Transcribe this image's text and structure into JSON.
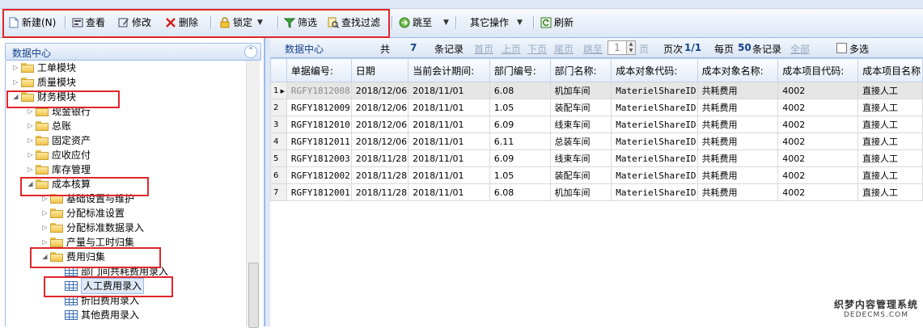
{
  "toolbar": {
    "new": "新建(N)",
    "view": "查看",
    "modify": "修改",
    "delete": "删除",
    "lock": "锁定",
    "filter": "筛选",
    "find_filter": "查找过滤",
    "jump": "跳至",
    "other_ops": "其它操作",
    "refresh": "刷新"
  },
  "left_panel": {
    "title": "数据中心",
    "tree": [
      {
        "label": "工单模块",
        "level": 0,
        "expanded": false
      },
      {
        "label": "质量模块",
        "level": 0,
        "expanded": false
      },
      {
        "label": "财务模块",
        "level": 0,
        "expanded": true
      },
      {
        "label": "现金银行",
        "level": 1,
        "expanded": false
      },
      {
        "label": "总账",
        "level": 1,
        "expanded": false
      },
      {
        "label": "固定资产",
        "level": 1,
        "expanded": false
      },
      {
        "label": "应收应付",
        "level": 1,
        "expanded": false
      },
      {
        "label": "库存管理",
        "level": 1,
        "expanded": false
      },
      {
        "label": "成本核算",
        "level": 1,
        "expanded": true
      },
      {
        "label": "基础设置与维护",
        "level": 2,
        "expanded": false
      },
      {
        "label": "分配标准设置",
        "level": 2,
        "expanded": false
      },
      {
        "label": "分配标准数据录入",
        "level": 2,
        "expanded": false
      },
      {
        "label": "产量与工时归集",
        "level": 2,
        "expanded": false
      },
      {
        "label": "费用归集",
        "level": 2,
        "expanded": true
      },
      {
        "label": "部门间共耗费用录入",
        "level": 3,
        "leaf": true
      },
      {
        "label": "人工费用录入",
        "level": 3,
        "leaf": true,
        "selected": true
      },
      {
        "label": "折旧费用录入",
        "level": 3,
        "leaf": true
      },
      {
        "label": "其他费用录入",
        "level": 3,
        "leaf": true
      }
    ]
  },
  "pager": {
    "title": "数据中心",
    "total_label": "共",
    "total": "7",
    "records_label": "条记录",
    "first": "首页",
    "prev": "上页",
    "next": "下页",
    "last": "尾页",
    "goto": "跳至",
    "page_input": "1",
    "page_unit": "页",
    "page_no_label": "页次",
    "page_no": "1/1",
    "per_page_label": "每页",
    "per_page": "50",
    "per_page_unit": "条记录",
    "all": "全部",
    "multi_select": "多选"
  },
  "grid": {
    "columns": [
      "单据编号:",
      "日期",
      "当前会计期间:",
      "部门编号:",
      "部门名称:",
      "成本对象代码:",
      "成本对象名称:",
      "成本项目代码:",
      "成本项目名称"
    ],
    "rows": [
      [
        "1",
        "RGFY1812008",
        "2018/12/06",
        "2018/11/01",
        "6.08",
        "机加车间",
        "MaterielShareID",
        "共耗费用",
        "4002",
        "直接人工"
      ],
      [
        "2",
        "RGFY1812009",
        "2018/12/06",
        "2018/11/01",
        "1.05",
        "装配车间",
        "MaterielShareID",
        "共耗费用",
        "4002",
        "直接人工"
      ],
      [
        "3",
        "RGFY1812010",
        "2018/12/06",
        "2018/11/01",
        "6.09",
        "线束车间",
        "MaterielShareID",
        "共耗费用",
        "4002",
        "直接人工"
      ],
      [
        "4",
        "RGFY1812011",
        "2018/12/06",
        "2018/11/01",
        "6.11",
        "总装车间",
        "MaterielShareID",
        "共耗费用",
        "4002",
        "直接人工"
      ],
      [
        "5",
        "RGFY1812003",
        "2018/11/28",
        "2018/11/01",
        "6.09",
        "线束车间",
        "MaterielShareID",
        "共耗费用",
        "4002",
        "直接人工"
      ],
      [
        "6",
        "RGFY1812002",
        "2018/11/28",
        "2018/11/01",
        "1.05",
        "装配车间",
        "MaterielShareID",
        "共耗费用",
        "4002",
        "直接人工"
      ],
      [
        "7",
        "RGFY1812001",
        "2018/11/28",
        "2018/11/01",
        "6.08",
        "机加车间",
        "MaterielShareID",
        "共耗费用",
        "4002",
        "直接人工"
      ]
    ]
  },
  "watermark": {
    "line1": "织梦内容管理系统",
    "line2": "DEDECMS.COM"
  },
  "colors": {
    "highlight": "#e0262b",
    "border": "#99bbe8",
    "header_text": "#15428b"
  }
}
